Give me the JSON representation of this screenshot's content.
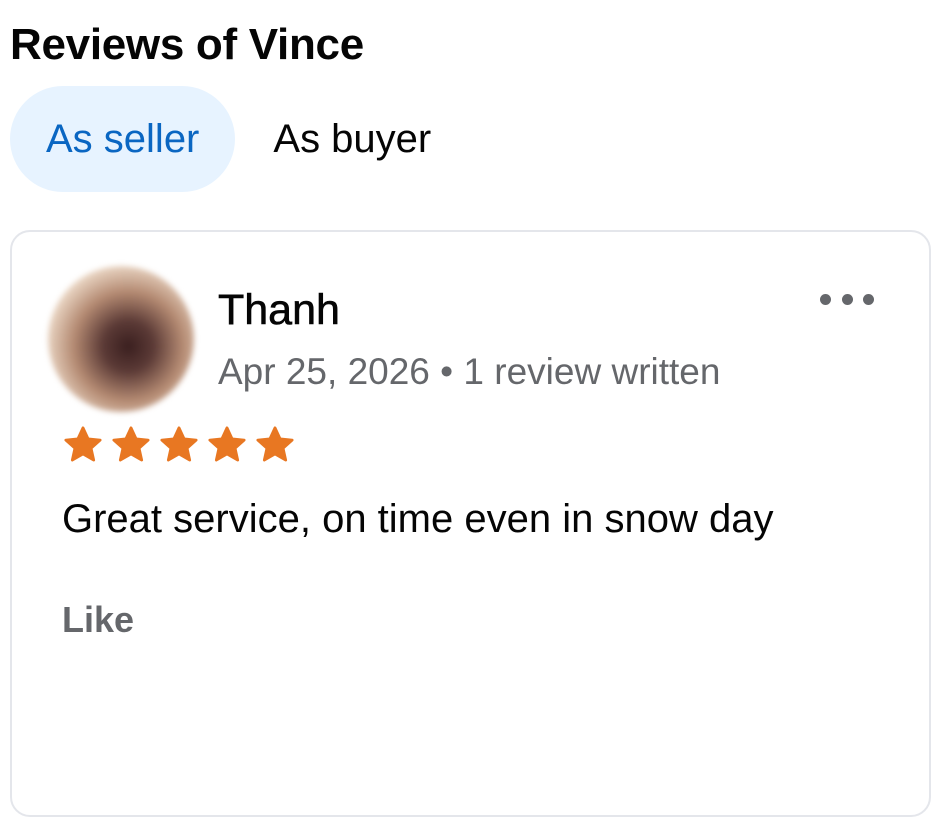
{
  "page": {
    "title": "Reviews of Vince"
  },
  "tabs": [
    {
      "label": "As seller",
      "active": true
    },
    {
      "label": "As buyer",
      "active": false
    }
  ],
  "review": {
    "reviewer_name": "Thanh",
    "date": "Apr 25, 2026",
    "separator": "•",
    "review_count": "1 review written",
    "rating": 5,
    "rating_max": 5,
    "text": "Great service, on time even in snow day",
    "like_label": "Like"
  },
  "icons": {
    "more": "more-options-icon",
    "star": "star-icon",
    "avatar": "avatar"
  },
  "colors": {
    "accent": "#0a66c2",
    "active_tab_bg": "#e7f3ff",
    "star": "#e87722",
    "secondary_text": "#65676b"
  }
}
